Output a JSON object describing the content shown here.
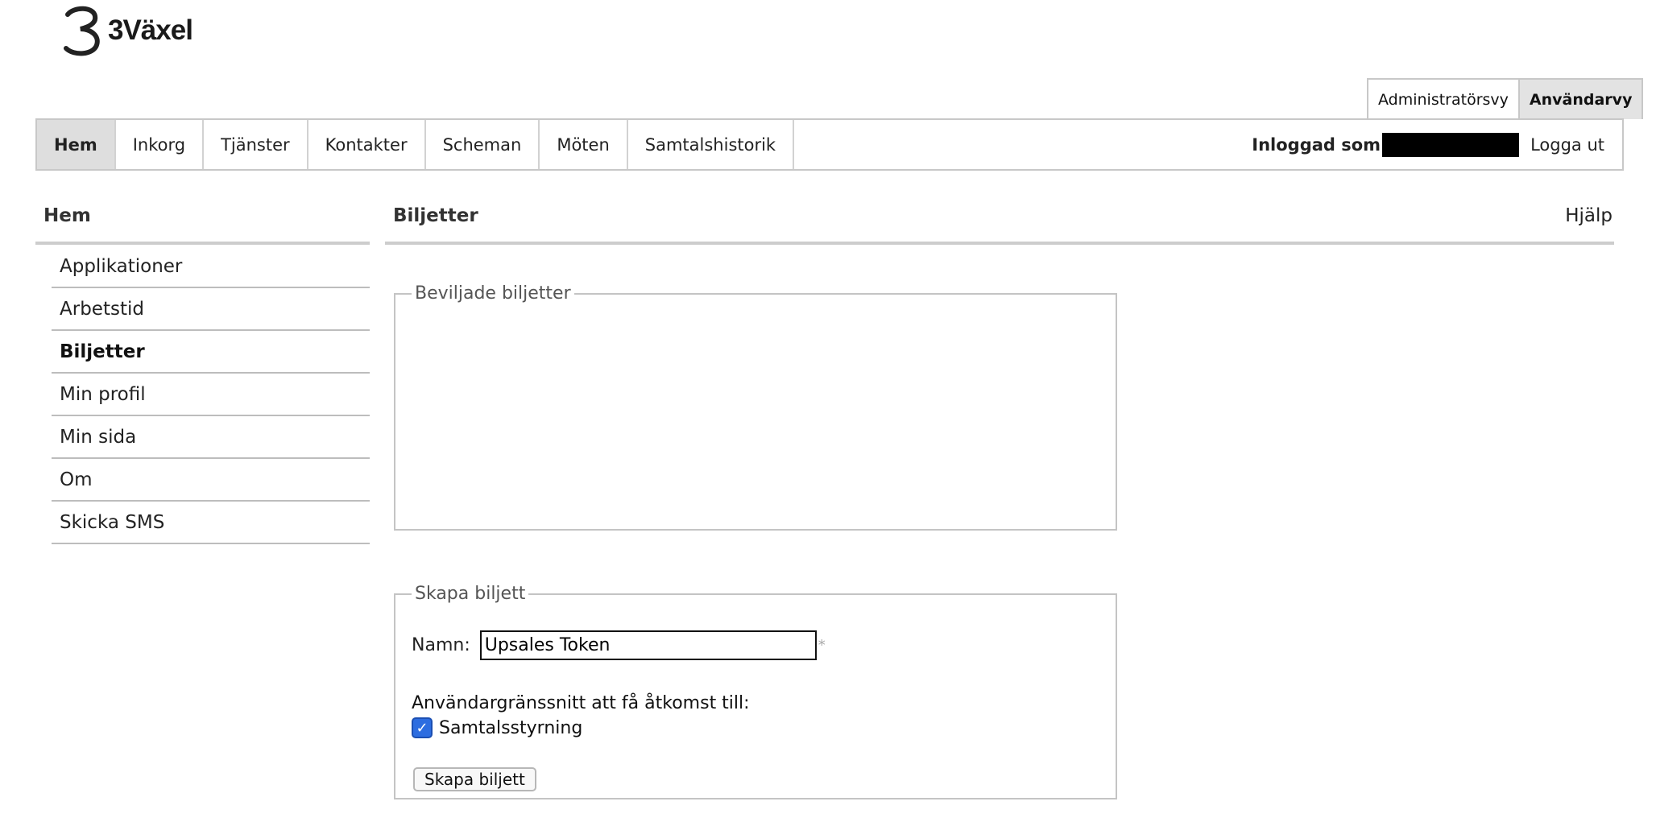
{
  "brand": {
    "name": "3Växel",
    "logo_icon": "three-logo-icon"
  },
  "view_switch": [
    {
      "label": "Administratörsvy",
      "active": false
    },
    {
      "label": "Användarvy",
      "active": true
    }
  ],
  "nav": {
    "items": [
      {
        "label": "Hem",
        "active": true
      },
      {
        "label": "Inkorg"
      },
      {
        "label": "Tjänster"
      },
      {
        "label": "Kontakter"
      },
      {
        "label": "Scheman"
      },
      {
        "label": "Möten"
      },
      {
        "label": "Samtalshistorik"
      }
    ],
    "logged_in_label": "Inloggad som",
    "logout_label": "Logga ut"
  },
  "sidebar": {
    "title": "Hem",
    "items": [
      {
        "label": "Applikationer"
      },
      {
        "label": "Arbetstid"
      },
      {
        "label": "Biljetter",
        "active": true
      },
      {
        "label": "Min profil"
      },
      {
        "label": "Min sida"
      },
      {
        "label": "Om"
      },
      {
        "label": "Skicka SMS"
      }
    ]
  },
  "main": {
    "title": "Biljetter",
    "help_label": "Hjälp",
    "granted": {
      "legend": "Beviljade biljetter"
    },
    "create": {
      "legend": "Skapa biljett",
      "name_label": "Namn:",
      "name_value": "Upsales Token",
      "required_mark": "*",
      "ui_access_label": "Användargränssnitt att få åtkomst till:",
      "checkbox_label": "Samtalsstyrning",
      "checkbox_checked": true,
      "checkbox_mark": "✓",
      "button_label": "Skapa biljett"
    }
  },
  "colors": {
    "nav_active_bg": "#dedede",
    "checkbox": "#2d6de0"
  }
}
